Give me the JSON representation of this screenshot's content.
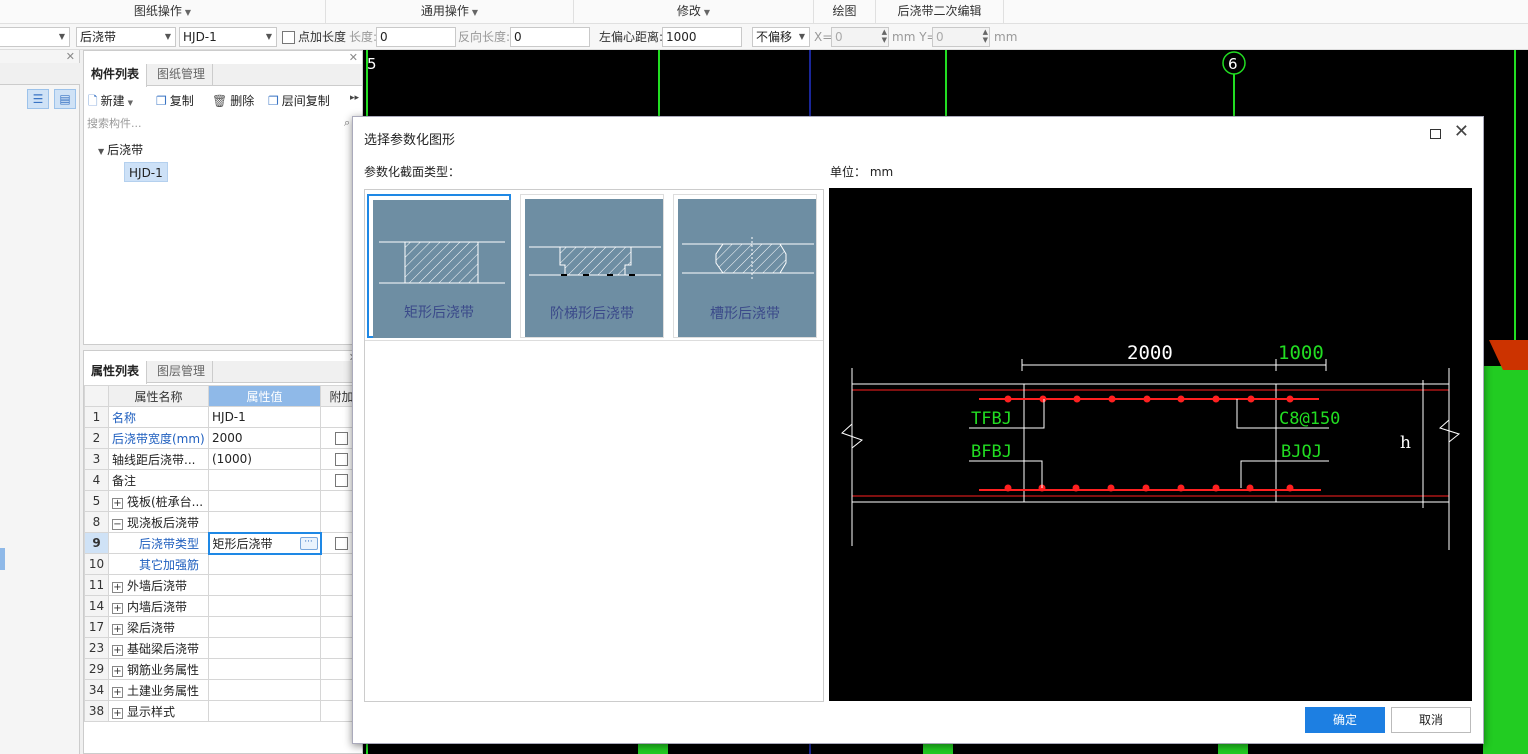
{
  "menubar": {
    "groups": [
      "图纸操作",
      "通用操作",
      "修改",
      "绘图",
      "后浇带二次编辑"
    ]
  },
  "toolbar": {
    "combo_category": "后浇带",
    "combo_element": "HJD-1",
    "add_length_label": "点加长度",
    "length_label": "长度:",
    "length_value": "0",
    "reverse_length_label": "反向长度:",
    "reverse_length_value": "0",
    "left_offset_label": "左偏心距离:",
    "left_offset_value": "1000",
    "offset_mode": "不偏移",
    "x_label": "X=",
    "x_value": "0",
    "y_label": "mm Y=",
    "y_value": "0",
    "unit": "mm"
  },
  "components": {
    "tabs": [
      "构件列表",
      "图纸管理"
    ],
    "actions": {
      "new": "新建",
      "copy": "复制",
      "delete": "删除",
      "floor_copy": "层间复制"
    },
    "search_placeholder": "搜索构件...",
    "tree_root": "后浇带",
    "tree_item": "HJD-1"
  },
  "properties": {
    "tabs": [
      "属性列表",
      "图层管理"
    ],
    "headers": {
      "name": "属性名称",
      "value": "属性值",
      "extra": "附加"
    },
    "rows": [
      {
        "no": "1",
        "name": "名称",
        "value": "HJD-1",
        "blue": true,
        "check": false,
        "toggle": ""
      },
      {
        "no": "2",
        "name": "后浇带宽度(mm)",
        "value": "2000",
        "blue": true,
        "check": true,
        "toggle": ""
      },
      {
        "no": "3",
        "name": "轴线距后浇带...",
        "value": "(1000)",
        "blue": false,
        "check": true,
        "toggle": ""
      },
      {
        "no": "4",
        "name": "备注",
        "value": "",
        "blue": false,
        "check": true,
        "toggle": ""
      },
      {
        "no": "5",
        "name": "筏板(桩承台...",
        "value": "",
        "blue": false,
        "check": false,
        "toggle": "+"
      },
      {
        "no": "8",
        "name": "现浇板后浇带",
        "value": "",
        "blue": false,
        "check": false,
        "toggle": "−"
      },
      {
        "no": "9",
        "name": "后浇带类型",
        "value": "矩形后浇带",
        "blue": true,
        "check": true,
        "toggle": "",
        "indent": true,
        "selected": true
      },
      {
        "no": "10",
        "name": "其它加强筋",
        "value": "",
        "blue": true,
        "check": false,
        "toggle": "",
        "indent": true
      },
      {
        "no": "11",
        "name": "外墙后浇带",
        "value": "",
        "blue": false,
        "check": false,
        "toggle": "+"
      },
      {
        "no": "14",
        "name": "内墙后浇带",
        "value": "",
        "blue": false,
        "check": false,
        "toggle": "+"
      },
      {
        "no": "17",
        "name": "梁后浇带",
        "value": "",
        "blue": false,
        "check": false,
        "toggle": "+"
      },
      {
        "no": "23",
        "name": "基础梁后浇带",
        "value": "",
        "blue": false,
        "check": false,
        "toggle": "+"
      },
      {
        "no": "29",
        "name": "钢筋业务属性",
        "value": "",
        "blue": false,
        "check": false,
        "toggle": "+"
      },
      {
        "no": "34",
        "name": "土建业务属性",
        "value": "",
        "blue": false,
        "check": false,
        "toggle": "+"
      },
      {
        "no": "38",
        "name": "显示样式",
        "value": "",
        "blue": false,
        "check": false,
        "toggle": "+"
      }
    ]
  },
  "canvas": {
    "axis_5": "5",
    "axis_6": "6"
  },
  "dialog": {
    "title": "选择参数化图形",
    "section_type_label": "参数化截面类型：",
    "unit_label": "单位：  mm",
    "shapes": [
      "矩形后浇带",
      "阶梯形后浇带",
      "槽形后浇带"
    ],
    "preview": {
      "dim_width": "2000",
      "dim_offset": "1000",
      "top_rebar": "TFBJ",
      "bottom_rebar": "BFBJ",
      "stirrup": "C8@150",
      "reinforce": "BJQJ",
      "height": "h"
    },
    "ok": "确定",
    "cancel": "取消"
  },
  "colors": {
    "accent": "#1d7fe2",
    "rebar": "#ff1a1a",
    "cad_green": "#22dd22"
  }
}
